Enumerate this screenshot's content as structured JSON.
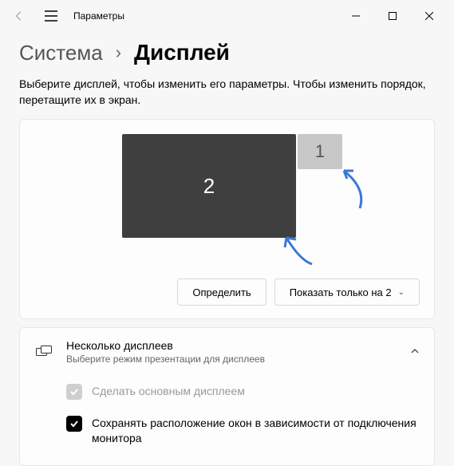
{
  "titlebar": {
    "title": "Параметры"
  },
  "breadcrumb": {
    "parent": "Система",
    "current": "Дисплей"
  },
  "description": "Выберите дисплей, чтобы изменить его параметры. Чтобы изменить порядок, перетащите их в экран.",
  "monitors": {
    "m1": "1",
    "m2": "2"
  },
  "buttons": {
    "identify": "Определить",
    "show_only": "Показать только на 2"
  },
  "section": {
    "title": "Несколько дисплеев",
    "subtitle": "Выберите режим презентации для дисплеев",
    "opt_main": "Сделать основным дисплеем",
    "opt_remember": "Сохранять расположение окон в зависимости от подключения монитора"
  }
}
